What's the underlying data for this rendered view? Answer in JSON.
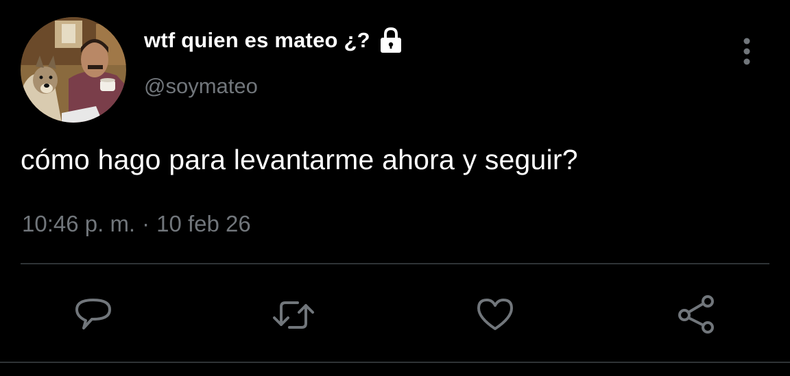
{
  "user": {
    "display_name": "wtf quien es mateo ¿?",
    "handle": "@soymateo",
    "protected_icon": "lock-icon",
    "avatar_icon": "profile-photo"
  },
  "tweet": {
    "text": "cómo hago para levantarme ahora y seguir?",
    "time": "10:46 p. m.",
    "separator": "·",
    "date": "10 feb 26"
  },
  "actions": [
    {
      "name": "reply",
      "icon": "reply-icon"
    },
    {
      "name": "retweet",
      "icon": "retweet-icon"
    },
    {
      "name": "like",
      "icon": "heart-icon"
    },
    {
      "name": "share",
      "icon": "share-icon"
    }
  ],
  "menu": {
    "icon": "more-vertical-icon"
  },
  "colors": {
    "background": "#000000",
    "primary_text": "#ffffff",
    "secondary_text": "#71767b",
    "divider": "#2f3336"
  }
}
